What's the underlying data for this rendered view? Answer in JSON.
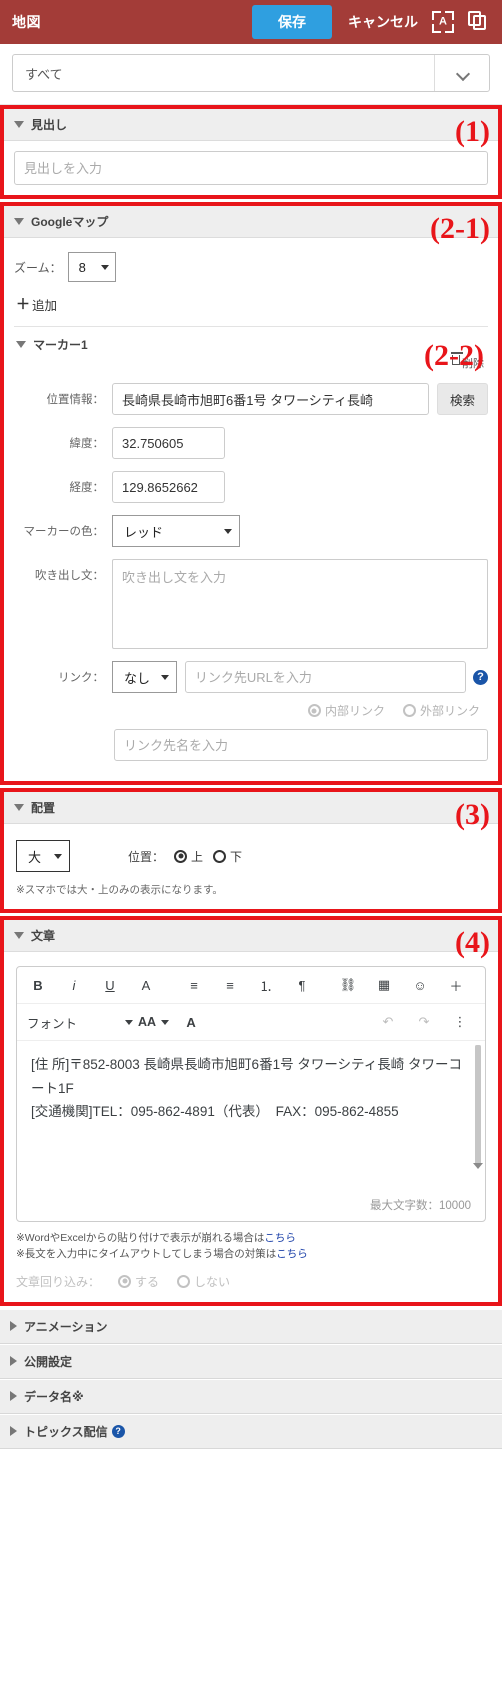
{
  "header": {
    "title": "地図",
    "save_label": "保存",
    "cancel_label": "キャンセル",
    "icon_a_label": "A",
    "accent_color": "#a33c38",
    "save_color": "#2f9fe0"
  },
  "filter": {
    "value": "すべて"
  },
  "sections": {
    "heading": {
      "tag": "(1)",
      "title": "見出し",
      "input_placeholder": "見出しを入力"
    },
    "googlemap": {
      "tag": "(2-1)",
      "title": "Googleマップ",
      "zoom_label": "ズーム：",
      "zoom_value": "8",
      "add_label": "追加"
    },
    "marker": {
      "tag": "(2-2)",
      "title": "マーカー1",
      "delete_label": "削除",
      "location_label": "位置情報：",
      "location_value": "長崎県長崎市旭町6番1号 タワーシティ長崎",
      "search_label": "検索",
      "lat_label": "緯度：",
      "lat_value": "32.750605",
      "lng_label": "経度：",
      "lng_value": "129.8652662",
      "color_label": "マーカーの色：",
      "color_value": "レッド",
      "balloon_label": "吹き出し文：",
      "balloon_placeholder": "吹き出し文を入力",
      "link_label": "リンク：",
      "link_value": "なし",
      "url_placeholder": "リンク先URLを入力",
      "help_glyph": "?",
      "radio_internal": "内部リンク",
      "radio_external": "外部リンク",
      "linkname_placeholder": "リンク先名を入力"
    },
    "layout": {
      "tag": "(3)",
      "title": "配置",
      "size_value": "大",
      "position_label": "位置：",
      "pos_top": "上",
      "pos_bottom": "下",
      "note": "※スマホでは大・上のみの表示になります。"
    },
    "text": {
      "tag": "(4)",
      "title": "文章",
      "toolbar_row1": [
        {
          "name": "bold",
          "glyph": "B"
        },
        {
          "name": "italic",
          "glyph": "i"
        },
        {
          "name": "underline",
          "glyph": "U"
        },
        {
          "name": "text-style",
          "glyph": "A"
        },
        {
          "name": "align-left",
          "glyph": "≡"
        },
        {
          "name": "align-center",
          "glyph": "≡"
        },
        {
          "name": "ordered-list",
          "glyph": "⒈"
        },
        {
          "name": "paragraph",
          "glyph": "¶"
        },
        {
          "name": "link",
          "glyph": "⛓"
        },
        {
          "name": "table",
          "glyph": "▦"
        },
        {
          "name": "emoji",
          "glyph": "☺"
        },
        {
          "name": "insert-more",
          "glyph": "＋"
        }
      ],
      "font_label": "フォント",
      "size_label": "AA",
      "text_color_glyph": "A",
      "undo_glyph": "↶",
      "redo_glyph": "↷",
      "kebab_glyph": "⋮",
      "content_lines": [
        "[住 所]〒852-8003 長崎県長崎市旭町6番1号 タワーシティ長崎 タワーコート1F",
        "[交通機関]TEL：095-862-4891（代表）　FAX：095-862-4855"
      ],
      "max_chars": "最大文字数：10000",
      "note_line1_pre": "※WordやExcelからの貼り付けで表示が崩れる場合は",
      "note_line1_link": "こちら",
      "note_line2_pre": "※長文を入力中にタイムアウトしてしまう場合の対策は",
      "note_line2_link": "こちら",
      "wrap_label": "文章回り込み：",
      "wrap_yes": "する",
      "wrap_no": "しない"
    }
  },
  "collapsed": [
    {
      "title": "アニメーション",
      "has_help": false
    },
    {
      "title": "公開設定",
      "has_help": false
    },
    {
      "title": "データ名※",
      "has_help": false
    },
    {
      "title": "トピックス配信",
      "has_help": true
    }
  ]
}
